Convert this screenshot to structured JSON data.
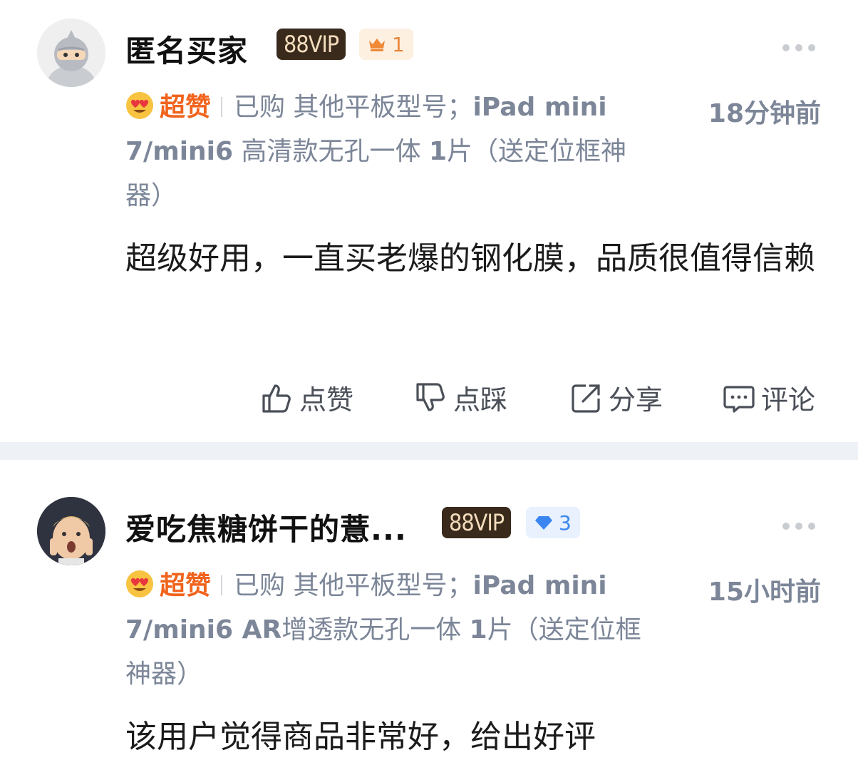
{
  "reviews": [
    {
      "user_name": "匿名买家",
      "vip_label": "88VIP",
      "level": "1",
      "badge": "超赞",
      "purchased_prefix": "已购 其他平板型号；",
      "purchased_bold1": "iPad mini 7/mini6",
      "purchased_rest1": " 高清款无孔一体 ",
      "purchased_bold2": "1",
      "purchased_rest2": "片（送定位框神器）",
      "time": "18分钟前",
      "content": "超级好用，一直买老爆的钢化膜，品质很值得信赖"
    },
    {
      "user_name": "爱吃焦糖饼干的薏...",
      "vip_label": "88VIP",
      "level": "3",
      "badge": "超赞",
      "purchased_prefix": "已购 其他平板型号；",
      "purchased_bold1": "iPad mini 7/mini6 AR",
      "purchased_rest1": "增透款无孔一体 ",
      "purchased_bold2": "1",
      "purchased_rest2": "片（送定位框神器）",
      "time": "15小时前",
      "content": "该用户觉得商品非常好，给出好评"
    }
  ],
  "actions": {
    "like": "点赞",
    "dislike": "点踩",
    "share": "分享",
    "comment": "评论"
  }
}
